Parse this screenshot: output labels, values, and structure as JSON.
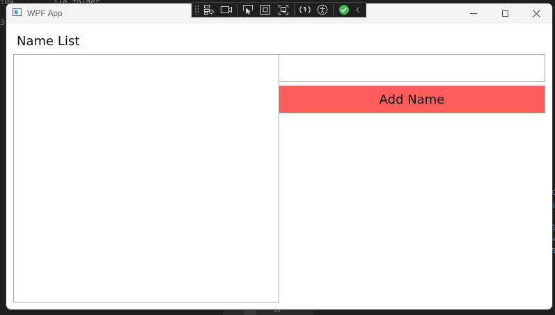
{
  "background": {
    "top_fragment_left": ":09",
    "top_fragment_mid": "ile folder",
    "left_fragment": "3:4",
    "bottom_number": "33"
  },
  "window": {
    "title": "WPF App"
  },
  "debug_toolbar": {
    "icons": [
      "grip-icon",
      "live-visual-tree-icon",
      "record-icon",
      "select-element-icon",
      "display-layout-adorners-icon",
      "track-focus-icon",
      "hot-reload-icon",
      "accessibility-icon",
      "binding-failures-check-icon",
      "collapse-chevron-icon"
    ],
    "check_color": "#3fb950"
  },
  "main": {
    "title": "Name List",
    "input": {
      "value": "",
      "placeholder": ""
    },
    "add_button_label": "Add Name",
    "add_button_color": "#ff5c5c",
    "name_list": {
      "items": []
    }
  }
}
